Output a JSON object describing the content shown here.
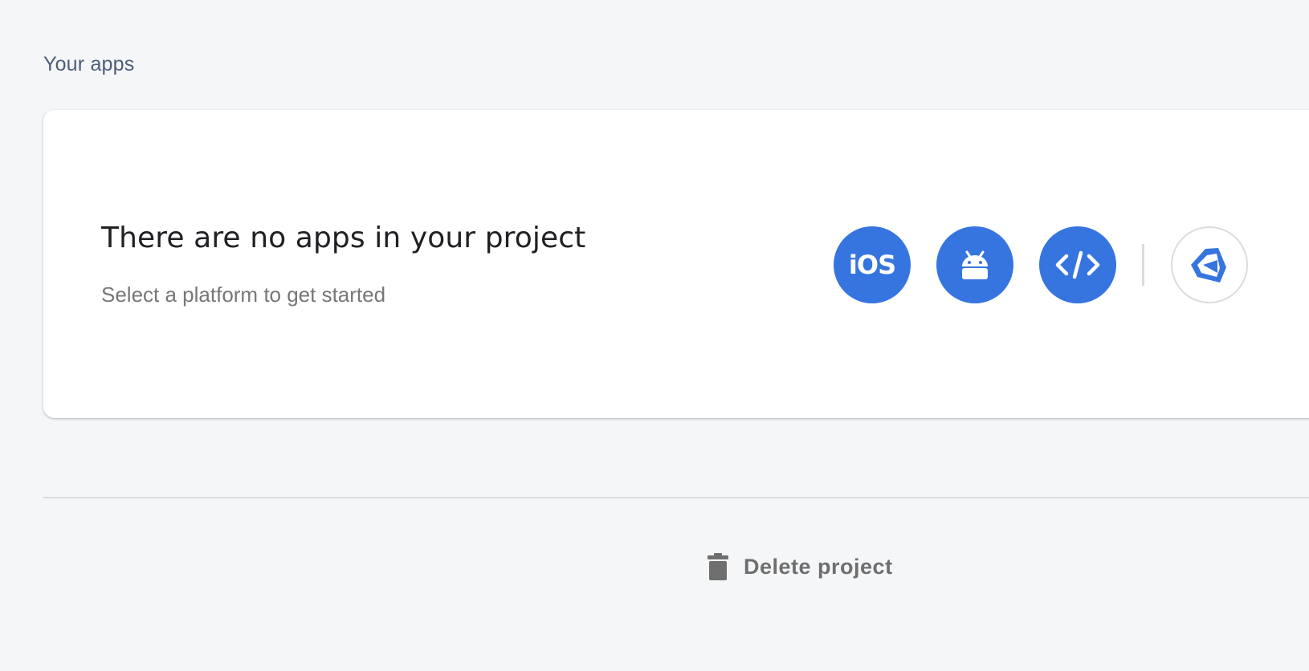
{
  "section": {
    "title": "Your apps"
  },
  "empty_state": {
    "heading": "There are no apps in your project",
    "subheading": "Select a platform to get started"
  },
  "platforms": [
    {
      "label": "iOS",
      "icon": "ios-icon"
    },
    {
      "label": "",
      "icon": "android-icon"
    },
    {
      "label": "",
      "icon": "web-code-icon"
    },
    {
      "label": "",
      "icon": "unity-icon"
    }
  ],
  "footer": {
    "delete_label": "Delete project",
    "delete_icon": "trash-icon"
  },
  "colors": {
    "accent": "#3675e0",
    "background": "#f5f6f8",
    "card": "#ffffff",
    "muted_text": "#777777",
    "section_title": "#4b5e78"
  }
}
